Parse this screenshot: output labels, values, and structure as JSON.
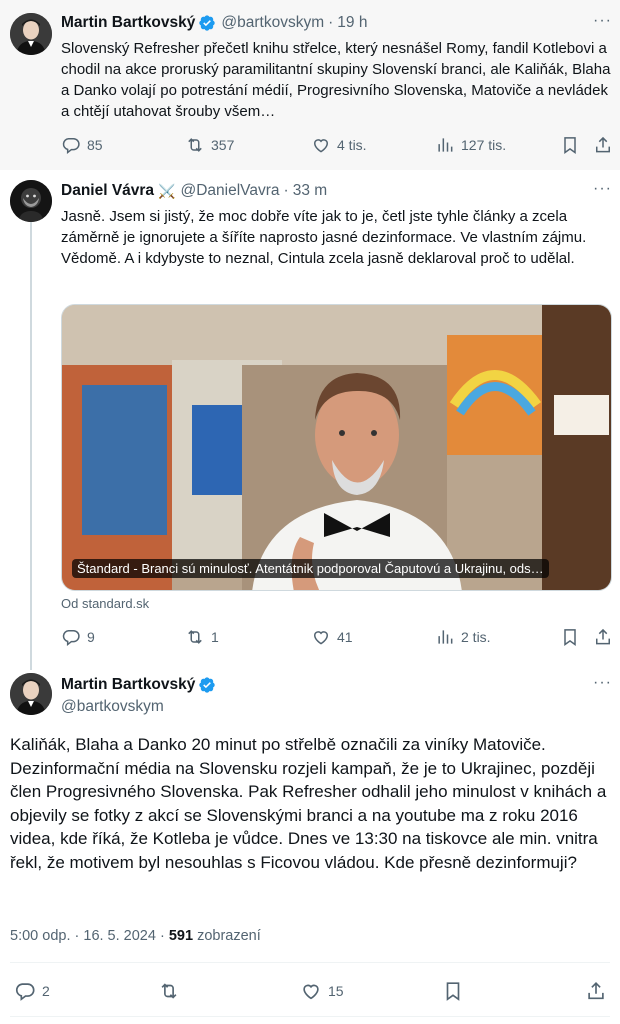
{
  "tweet1": {
    "name": "Martin Bartkovský",
    "handle": "@bartkovskym",
    "time": "19 h",
    "text": "Slovenský Refresher přečetl knihu střelce, který nesnášel Romy, fandil Kotlebovi a chodil na akce proruský paramilitantní skupiny Slovenskí branci, ale Kaliňák, Blaha a Danko volají po potrestání médií, Progresivního Slovenska, Matoviče a nevládek a chtějí utahovat šrouby všem…",
    "replies": "85",
    "reposts": "357",
    "likes": "4 tis.",
    "views": "127 tis."
  },
  "tweet2": {
    "name": "Daniel Vávra",
    "name_emoji": "⚔️",
    "handle": "@DanielVavra",
    "time": "33 m",
    "text": "Jasně. Jsem si jistý, že moc dobře víte jak to je, četl jste tyhle články a zcela záměrně je ignorujete a šíříte naprosto jasné dezinformace. Ve vlastním zájmu. Vědomě. A i kdybyste to neznal, Cintula zcela jasně deklaroval proč to udělal.",
    "card_caption": "Štandard - Branci sú minulosť. Atentátnik podporoval Čaputovú a Ukrajinu, ods…",
    "card_source": "Od standard.sk",
    "card_image": "photo-bearded-man-bowtie-glasses",
    "replies": "9",
    "reposts": "1",
    "likes": "41",
    "views": "2 tis."
  },
  "tweet3": {
    "name": "Martin Bartkovský",
    "handle": "@bartkovskym",
    "text": "Kaliňák, Blaha a Danko 20 minut po střelbě označili za viníky Matoviče. Dezinformační média na Slovensku rozjeli kampaň, že je to Ukrajinec, později člen Progresivného Slovenska. Pak Refresher odhalil jeho minulost v knihách a objevily se fotky z akcí se Slovenskými branci a na youtube ma z roku 2016 videa, kde říká, že Kotleba je vůdce. Dnes ve 13:30 na tiskovce ale min. vnitra řekl, že motivem byl nesouhlas s Ficovou vládou. Kde přesně dezinformuji?",
    "time": "5:00 odp.",
    "date": "16. 5. 2024",
    "views_count": "591",
    "views_label": "zobrazení",
    "replies": "2",
    "likes": "15"
  },
  "colors": {
    "verified": "#1d9bf0",
    "secondary_text": "#536471",
    "primary_text": "#0f1419"
  }
}
